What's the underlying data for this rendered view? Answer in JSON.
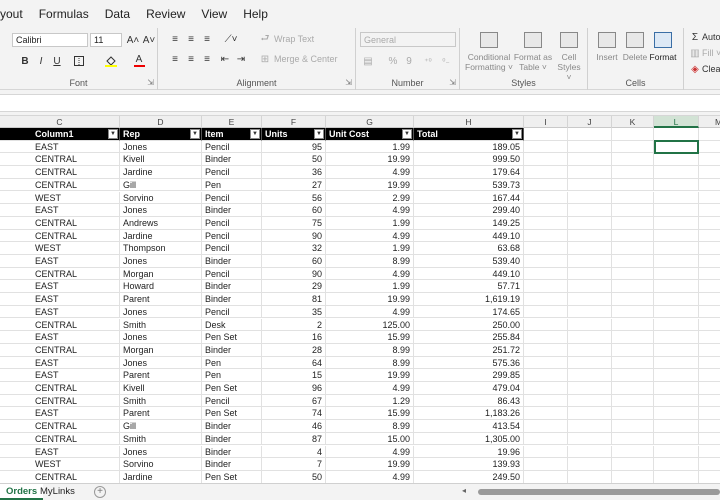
{
  "menu": [
    "yout",
    "Formulas",
    "Data",
    "Review",
    "View",
    "Help"
  ],
  "ribbon": {
    "font": {
      "name": "Calibri",
      "size": "11",
      "grow": "A˄",
      "shrink": "A˅",
      "bold": "B",
      "italic": "I",
      "underline": "U",
      "label": "Font"
    },
    "alignment": {
      "wrap_text": "Wrap Text",
      "merge_center": "Merge & Center",
      "label": "Alignment"
    },
    "number": {
      "format": "General",
      "percent": "%",
      "comma": "9",
      "label": "Number"
    },
    "styles": {
      "conditional": [
        "Conditional",
        "Formatting ˅"
      ],
      "format_table": [
        "Format as",
        "Table ˅"
      ],
      "cell_styles": [
        "Cell",
        "Styles ˅"
      ],
      "label": "Styles"
    },
    "cells": {
      "insert": "Insert",
      "delete": "Delete",
      "format": "Format",
      "label": "Cells"
    },
    "editing": {
      "autosum": "Auto",
      "fill": "Fill ˅",
      "clear": "Clea"
    }
  },
  "column_letters": [
    "C",
    "D",
    "E",
    "F",
    "G",
    "H",
    "I",
    "J",
    "K",
    "L",
    "M"
  ],
  "table": {
    "headers": [
      "Column1",
      "Rep",
      "Item",
      "Units",
      "Unit Cost",
      "Total"
    ],
    "rows": [
      [
        "EAST",
        "Jones",
        "Pencil",
        "95",
        "1.99",
        "189.05"
      ],
      [
        "CENTRAL",
        "Kivell",
        "Binder",
        "50",
        "19.99",
        "999.50"
      ],
      [
        "CENTRAL",
        "Jardine",
        "Pencil",
        "36",
        "4.99",
        "179.64"
      ],
      [
        "CENTRAL",
        "Gill",
        "Pen",
        "27",
        "19.99",
        "539.73"
      ],
      [
        "WEST",
        "Sorvino",
        "Pencil",
        "56",
        "2.99",
        "167.44"
      ],
      [
        "EAST",
        "Jones",
        "Binder",
        "60",
        "4.99",
        "299.40"
      ],
      [
        "CENTRAL",
        "Andrews",
        "Pencil",
        "75",
        "1.99",
        "149.25"
      ],
      [
        "CENTRAL",
        "Jardine",
        "Pencil",
        "90",
        "4.99",
        "449.10"
      ],
      [
        "WEST",
        "Thompson",
        "Pencil",
        "32",
        "1.99",
        "63.68"
      ],
      [
        "EAST",
        "Jones",
        "Binder",
        "60",
        "8.99",
        "539.40"
      ],
      [
        "CENTRAL",
        "Morgan",
        "Pencil",
        "90",
        "4.99",
        "449.10"
      ],
      [
        "EAST",
        "Howard",
        "Binder",
        "29",
        "1.99",
        "57.71"
      ],
      [
        "EAST",
        "Parent",
        "Binder",
        "81",
        "19.99",
        "1,619.19"
      ],
      [
        "EAST",
        "Jones",
        "Pencil",
        "35",
        "4.99",
        "174.65"
      ],
      [
        "CENTRAL",
        "Smith",
        "Desk",
        "2",
        "125.00",
        "250.00"
      ],
      [
        "EAST",
        "Jones",
        "Pen Set",
        "16",
        "15.99",
        "255.84"
      ],
      [
        "CENTRAL",
        "Morgan",
        "Binder",
        "28",
        "8.99",
        "251.72"
      ],
      [
        "EAST",
        "Jones",
        "Pen",
        "64",
        "8.99",
        "575.36"
      ],
      [
        "EAST",
        "Parent",
        "Pen",
        "15",
        "19.99",
        "299.85"
      ],
      [
        "CENTRAL",
        "Kivell",
        "Pen Set",
        "96",
        "4.99",
        "479.04"
      ],
      [
        "CENTRAL",
        "Smith",
        "Pencil",
        "67",
        "1.29",
        "86.43"
      ],
      [
        "EAST",
        "Parent",
        "Pen Set",
        "74",
        "15.99",
        "1,183.26"
      ],
      [
        "CENTRAL",
        "Gill",
        "Binder",
        "46",
        "8.99",
        "413.54"
      ],
      [
        "CENTRAL",
        "Smith",
        "Binder",
        "87",
        "15.00",
        "1,305.00"
      ],
      [
        "EAST",
        "Jones",
        "Binder",
        "4",
        "4.99",
        "19.96"
      ],
      [
        "WEST",
        "Sorvino",
        "Binder",
        "7",
        "19.99",
        "139.93"
      ],
      [
        "CENTRAL",
        "Jardine",
        "Pen Set",
        "50",
        "4.99",
        "249.50"
      ]
    ]
  },
  "sheets": [
    "Orders",
    "MyLinks"
  ],
  "active_sheet": "Orders",
  "add_sheet": "+",
  "accent": "#217346"
}
